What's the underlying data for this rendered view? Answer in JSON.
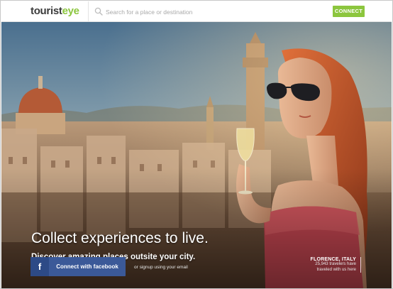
{
  "header": {
    "logo_part1": "tourist",
    "logo_part2": "eye",
    "search_placeholder": "Search for a place or destination",
    "connect_label": "CONNECT",
    "accent_color": "#8cc63e"
  },
  "hero": {
    "headline": "Collect experiences to live.",
    "subline": "Discover amazing places outsite your city.",
    "facebook_icon": "f",
    "facebook_label": "Connect with facebook",
    "signup_text": "or signup using your email",
    "location_name": "FLORENCE, ITALY",
    "location_count": "25,943 travelers have traveled with us here",
    "facebook_color": "#3b5998"
  }
}
